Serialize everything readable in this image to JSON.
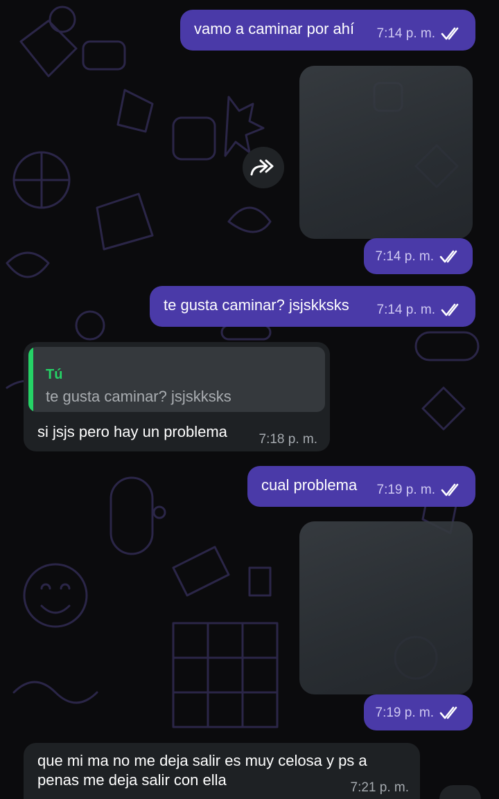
{
  "chat": {
    "messages": [
      {
        "id": "m1",
        "dir": "out",
        "type": "text",
        "text": "vamo a caminar por ahí",
        "time": "7:14 p. m.",
        "status": "read"
      },
      {
        "id": "m2",
        "dir": "out",
        "type": "image",
        "time": "7:14 p. m.",
        "status": "read"
      },
      {
        "id": "m3",
        "dir": "out",
        "type": "text",
        "text": "te gusta caminar? jsjskksks",
        "time": "7:14 p. m.",
        "status": "read"
      },
      {
        "id": "m4",
        "dir": "in",
        "type": "reply",
        "quote_author": "Tú",
        "quote_text": "te gusta caminar? jsjskksks",
        "text": "si jsjs pero hay un problema",
        "time": "7:18 p. m."
      },
      {
        "id": "m5",
        "dir": "out",
        "type": "text",
        "text": "cual problema",
        "time": "7:19 p. m.",
        "status": "read"
      },
      {
        "id": "m6",
        "dir": "out",
        "type": "image",
        "time": "7:19 p. m.",
        "status": "read"
      },
      {
        "id": "m7",
        "dir": "in",
        "type": "text",
        "text_line1": "que mi ma no me deja salir es muy celosa y ps a",
        "text_line2": "penas  me deja salir con ella",
        "time": "7:21 p. m."
      }
    ]
  },
  "icons": {
    "forward": "forward-icon",
    "read_ticks": "double-check-icon"
  },
  "colors": {
    "outgoing_bubble": "#4a3aa8",
    "incoming_bubble": "#1e2124",
    "quote_accent": "#25d366",
    "background": "#0b0b0d"
  }
}
